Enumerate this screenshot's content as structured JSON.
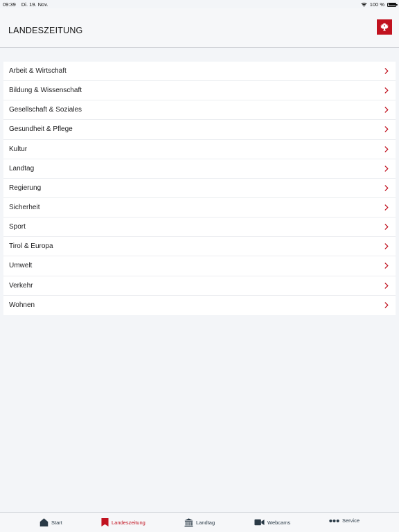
{
  "status": {
    "time": "09:39",
    "date": "Di. 19. Nov.",
    "battery": "100 %"
  },
  "header": {
    "title": "LANDESZEITUNG",
    "logo_icon": "tyrol-eagle-crest-icon",
    "brand_color": "#c1121f"
  },
  "categories": [
    {
      "label": "Arbeit & Wirtschaft"
    },
    {
      "label": "Bildung & Wissenschaft"
    },
    {
      "label": "Gesellschaft & Soziales"
    },
    {
      "label": "Gesundheit & Pflege"
    },
    {
      "label": "Kultur"
    },
    {
      "label": "Landtag"
    },
    {
      "label": "Regierung"
    },
    {
      "label": "Sicherheit"
    },
    {
      "label": "Sport"
    },
    {
      "label": "Tirol & Europa"
    },
    {
      "label": "Umwelt"
    },
    {
      "label": "Verkehr"
    },
    {
      "label": "Wohnen"
    }
  ],
  "tabs": [
    {
      "label": "Start",
      "icon": "house-icon"
    },
    {
      "label": "Landeszeitung",
      "icon": "bookmark-icon",
      "active": true
    },
    {
      "label": "Landtag",
      "icon": "parliament-icon"
    },
    {
      "label": "Webcams",
      "icon": "video-camera-icon"
    },
    {
      "label": "Service",
      "icon": "more-dots-icon"
    }
  ]
}
